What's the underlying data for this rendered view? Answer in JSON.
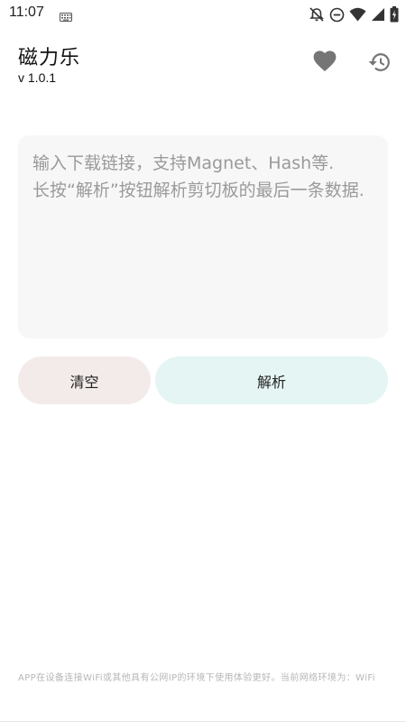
{
  "status_bar": {
    "time": "11:07",
    "icons": [
      "keyboard-icon",
      "alarm-off-icon",
      "do-not-disturb-icon",
      "wifi-icon",
      "signal-icon",
      "battery-icon"
    ]
  },
  "header": {
    "title": "磁力乐",
    "version": "v 1.0.1",
    "actions": [
      "heart-icon",
      "history-icon"
    ]
  },
  "input": {
    "value": "",
    "placeholder": "输入下载链接，支持Magnet、Hash等.\n长按“解析”按钮解析剪切板的最后一条数据."
  },
  "buttons": {
    "clear_label": "清空",
    "parse_label": "解析"
  },
  "footer": {
    "note": "APP在设备连接WiFi或其他具有公网IP的环境下使用体验更好。当前网络环境为：WiFi"
  },
  "colors": {
    "input_background": "#f7f7f7",
    "clear_button": "#f2ebea",
    "parse_button": "#e4f5f3",
    "icon_gray": "#757575",
    "footer_text": "#b6b6b6"
  }
}
